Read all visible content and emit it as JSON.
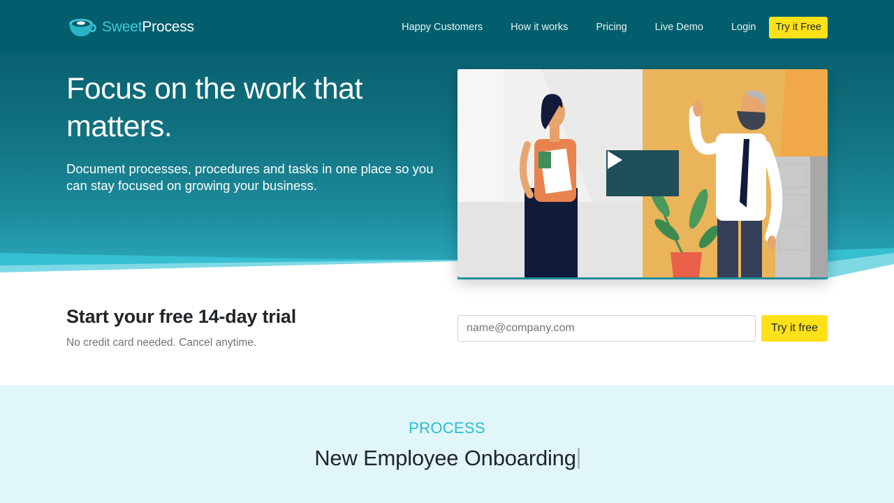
{
  "brand": {
    "sweet": "Sweet",
    "process": "Process",
    "logo_icon": "teacup-icon"
  },
  "nav": {
    "items": [
      {
        "label": "Happy Customers"
      },
      {
        "label": "How it works"
      },
      {
        "label": "Pricing"
      },
      {
        "label": "Live Demo"
      },
      {
        "label": "Login"
      }
    ],
    "cta": "Try it Free"
  },
  "hero": {
    "title": "Focus on the work that matters.",
    "subtitle": "Document processes, procedures and tasks in one place so you can stay focused on growing your business.",
    "video_play_icon": "play-icon"
  },
  "trial": {
    "title": "Start your free 14-day trial",
    "subtitle": "No credit card needed. Cancel anytime.",
    "email_placeholder": "name@company.com",
    "button": "Try it free"
  },
  "process": {
    "label": "PROCESS",
    "title": "New Employee Onboarding"
  },
  "colors": {
    "brand_teal": "#025e6c",
    "accent_cyan": "#3ec9dc",
    "cta_yellow": "#ffe11a",
    "section_bg": "#e0f6f9"
  }
}
